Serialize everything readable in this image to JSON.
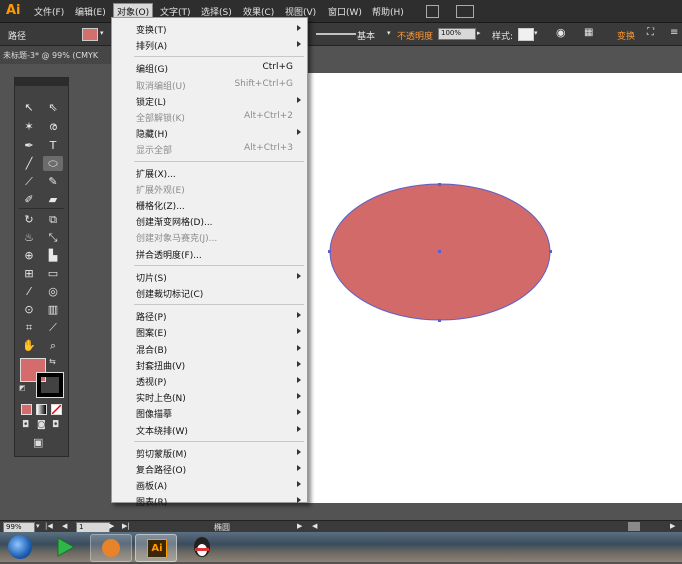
{
  "app": {
    "logo": "Ai"
  },
  "menubar": {
    "items": [
      "文件(F)",
      "编辑(E)",
      "对象(O)",
      "文字(T)",
      "选择(S)",
      "效果(C)",
      "视图(V)",
      "窗口(W)",
      "帮助(H)"
    ],
    "active_index": 2
  },
  "control_bar": {
    "object_type": "路径",
    "fill_color": "#d4706c",
    "stroke_style": "基本",
    "opacity_label": "不透明度",
    "opacity_value": "100%",
    "style_label": "样式:",
    "transform_label": "变换"
  },
  "document": {
    "tab_title": "未标题-3* @ 99% (CMYK"
  },
  "canvas": {
    "ellipse_fill": "#d36a6a",
    "ellipse_stroke": "#5b5fc9"
  },
  "toolbox": {
    "fill_color": "#d46c6c",
    "stroke_color": "#000000"
  },
  "object_menu": {
    "items": [
      {
        "label": "变换(T)",
        "shortcut": "",
        "submenu": true,
        "disabled": false
      },
      {
        "label": "排列(A)",
        "shortcut": "",
        "submenu": true,
        "disabled": false
      },
      {
        "sep": true
      },
      {
        "label": "编组(G)",
        "shortcut": "Ctrl+G",
        "submenu": false,
        "disabled": false
      },
      {
        "label": "取消编组(U)",
        "shortcut": "Shift+Ctrl+G",
        "submenu": false,
        "disabled": true
      },
      {
        "label": "锁定(L)",
        "shortcut": "",
        "submenu": true,
        "disabled": false
      },
      {
        "label": "全部解锁(K)",
        "shortcut": "Alt+Ctrl+2",
        "submenu": false,
        "disabled": true
      },
      {
        "label": "隐藏(H)",
        "shortcut": "",
        "submenu": true,
        "disabled": false
      },
      {
        "label": "显示全部",
        "shortcut": "Alt+Ctrl+3",
        "submenu": false,
        "disabled": true
      },
      {
        "sep": true
      },
      {
        "label": "扩展(X)...",
        "shortcut": "",
        "submenu": false,
        "disabled": false
      },
      {
        "label": "扩展外观(E)",
        "shortcut": "",
        "submenu": false,
        "disabled": true
      },
      {
        "label": "栅格化(Z)...",
        "shortcut": "",
        "submenu": false,
        "disabled": false
      },
      {
        "label": "创建渐变网格(D)...",
        "shortcut": "",
        "submenu": false,
        "disabled": false
      },
      {
        "label": "创建对象马赛克(J)...",
        "shortcut": "",
        "submenu": false,
        "disabled": true
      },
      {
        "label": "拼合透明度(F)...",
        "shortcut": "",
        "submenu": false,
        "disabled": false
      },
      {
        "sep": true
      },
      {
        "label": "切片(S)",
        "shortcut": "",
        "submenu": true,
        "disabled": false
      },
      {
        "label": "创建裁切标记(C)",
        "shortcut": "",
        "submenu": false,
        "disabled": false
      },
      {
        "sep": true
      },
      {
        "label": "路径(P)",
        "shortcut": "",
        "submenu": true,
        "disabled": false
      },
      {
        "label": "图案(E)",
        "shortcut": "",
        "submenu": true,
        "disabled": false
      },
      {
        "label": "混合(B)",
        "shortcut": "",
        "submenu": true,
        "disabled": false
      },
      {
        "label": "封套扭曲(V)",
        "shortcut": "",
        "submenu": true,
        "disabled": false
      },
      {
        "label": "透视(P)",
        "shortcut": "",
        "submenu": true,
        "disabled": false
      },
      {
        "label": "实时上色(N)",
        "shortcut": "",
        "submenu": true,
        "disabled": false
      },
      {
        "label": "图像描摹",
        "shortcut": "",
        "submenu": true,
        "disabled": false
      },
      {
        "label": "文本绕排(W)",
        "shortcut": "",
        "submenu": true,
        "disabled": false
      },
      {
        "sep": true
      },
      {
        "label": "剪切蒙版(M)",
        "shortcut": "",
        "submenu": true,
        "disabled": false
      },
      {
        "label": "复合路径(O)",
        "shortcut": "",
        "submenu": true,
        "disabled": false
      },
      {
        "label": "画板(A)",
        "shortcut": "",
        "submenu": true,
        "disabled": false
      },
      {
        "label": "图表(R)",
        "shortcut": "",
        "submenu": true,
        "disabled": false
      }
    ]
  },
  "status_bar": {
    "zoom": "99%",
    "artboard_number": "1",
    "tool_name": "椭圆"
  },
  "taskbar": {
    "ai_label": "Ai"
  }
}
